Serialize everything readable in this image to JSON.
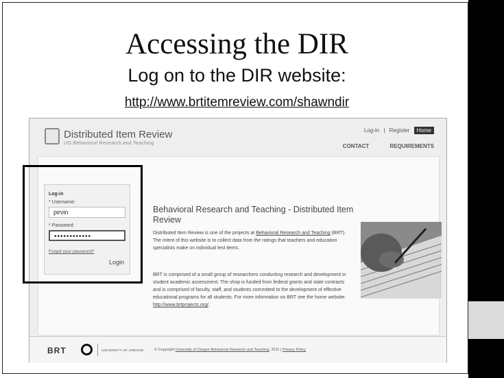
{
  "slide": {
    "title": "Accessing the DIR",
    "subtitle": "Log on to the DIR website:",
    "url": "http://www.brtitemreview.com/shawndir"
  },
  "site": {
    "name": "Distributed Item Review",
    "subtitle": "UO Behavioral Research and Teaching",
    "top_links": {
      "login": "Log-in",
      "sep": "|",
      "register": "Register",
      "home": "Home"
    },
    "nav": {
      "contact": "CONTACT",
      "requirements": "REQUIREMENTS"
    }
  },
  "login": {
    "heading": "Log-in",
    "username_label": "* Username:",
    "username_value": "pirvin",
    "password_label": "* Password:",
    "password_value": "••••••••••••",
    "forgot": "Forgot your password?",
    "button": "Login"
  },
  "content": {
    "title": "Behavioral Research and Teaching - Distributed Item Review",
    "p1_a": "Distributed Item Review is one of the projects at ",
    "p1_link": "Behavioral Research and Teaching",
    "p1_b": " (BRT). The intent of this website is to collect data from the ratings that teachers and education specialists make on individual test items.",
    "p2_a": "BRT is comprised of a small group of researchers conducting research and development in student academic assessment. The shop is funded from federal grants and state contracts and is comprised of faculty, staff, and students committed to the development of effective educational programs for all students. For more information on BRT see the home website: ",
    "p2_link": "http://www.brtprojects.org/",
    "p2_end": "."
  },
  "footer": {
    "brt": "BRT",
    "uo": "UNIVERSITY OF OREGON",
    "copy_a": "© Copyright ",
    "copy_link": "University of Oregon Behavioral Research and Teaching",
    "copy_b": ", 2011 | ",
    "privacy": "Privacy Policy"
  }
}
